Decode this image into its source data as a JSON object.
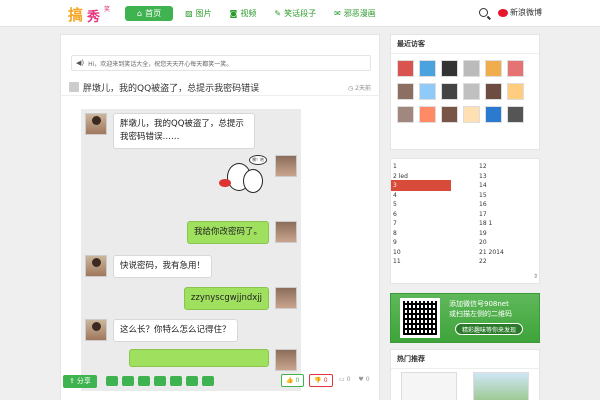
{
  "header": {
    "nav": [
      {
        "label": "首页",
        "icon": "home-icon",
        "active": true
      },
      {
        "label": "图片",
        "icon": "image-icon",
        "active": false
      },
      {
        "label": "视频",
        "icon": "camera-icon",
        "active": false
      },
      {
        "label": "笑话段子",
        "icon": "pin-icon",
        "active": false
      },
      {
        "label": "邪恶漫画",
        "icon": "chat-icon",
        "active": false
      }
    ],
    "weibo_label": "新浪微博"
  },
  "notice": {
    "text": "Hi，欢迎来到笑话大全，祝您天天开心每天都笑一笑。"
  },
  "post": {
    "title": "胖墩儿，我的QQ被盗了，总提示我密码错误",
    "time": "2天前",
    "messages": [
      {
        "side": "left",
        "text": "胖墩儿，我的QQ被盗了，总提示我密码错误……"
      },
      {
        "side": "right",
        "type": "sticker",
        "sticker_text": "嘿！哈"
      },
      {
        "side": "right",
        "text": "我给你改密码了。"
      },
      {
        "side": "left",
        "text": "快说密码，我有急用！"
      },
      {
        "side": "right",
        "text": "zzynyscgwjjndxjj"
      },
      {
        "side": "left",
        "text": "这么长？你特么怎么记得住？"
      }
    ],
    "share_label": "分享",
    "up_count": "0",
    "down_count": "0",
    "comment_count": "0",
    "fav_count": "0"
  },
  "sidebar": {
    "visitors_title": "最近访客",
    "visitor_count": 18,
    "calendar": {
      "left": [
        "1",
        "2 led",
        "3",
        "4",
        "5",
        "6",
        "7",
        "8",
        "9",
        "10",
        "11"
      ],
      "right": [
        "12",
        "13",
        "14",
        "15",
        "16",
        "17",
        "18 1",
        "19",
        "20",
        "21 2014",
        "22"
      ]
    },
    "qr": {
      "line1": "添加微信号908net",
      "line2": "或扫描左侧的二维码",
      "button": "精彩趣味等你来发现"
    },
    "section3_title": "热门推荐"
  }
}
